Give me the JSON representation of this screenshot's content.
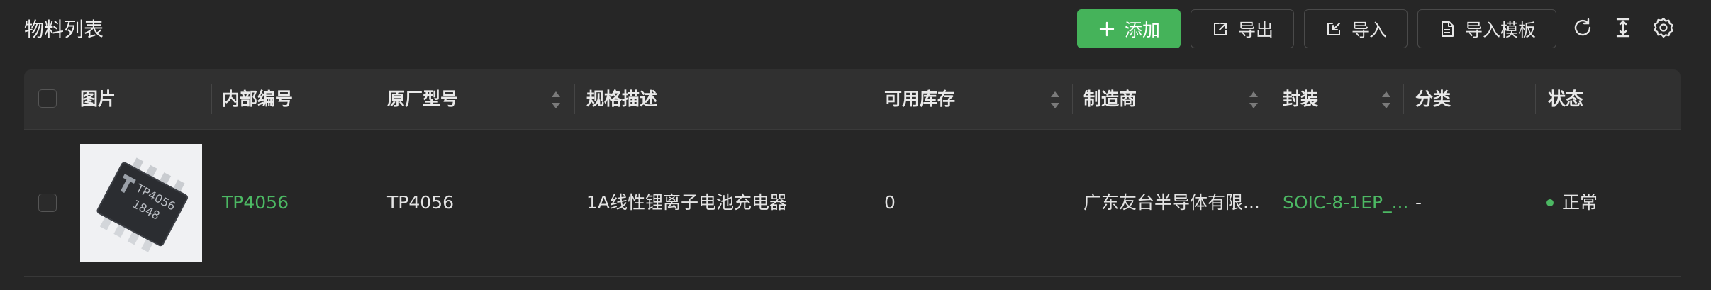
{
  "header": {
    "title": "物料列表",
    "buttons": {
      "add": "添加",
      "export": "导出",
      "import": "导入",
      "import_template": "导入模板"
    },
    "tools": [
      "refresh-icon",
      "column-height-icon",
      "settings-icon"
    ]
  },
  "table": {
    "columns": {
      "image": "图片",
      "internal_no": "内部编号",
      "mfr_part": "原厂型号",
      "spec": "规格描述",
      "stock": "可用库存",
      "manufacturer": "制造商",
      "package": "封装",
      "category": "分类",
      "status": "状态"
    },
    "rows": [
      {
        "chip_marking_1": "TP4056",
        "chip_marking_2": "1848",
        "internal_no": "TP4056",
        "mfr_part": "TP4056",
        "spec": "1A线性锂离子电池充电器",
        "stock": "0",
        "manufacturer": "广东友台半导体有限...",
        "package": "SOIC-8-1EP_...",
        "category": "-",
        "status": "正常"
      }
    ]
  },
  "colors": {
    "accent": "#45b35a",
    "link": "#4cb863",
    "background": "#262626",
    "header_bg": "#303030"
  }
}
